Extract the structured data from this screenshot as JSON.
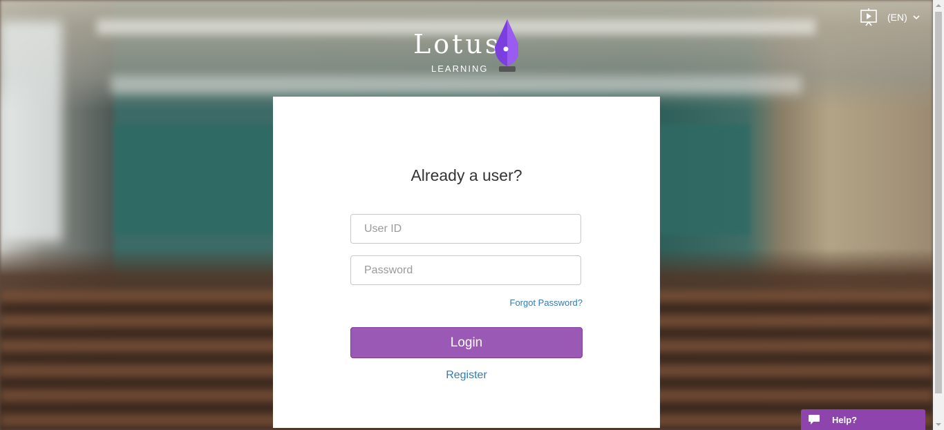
{
  "brand": {
    "name": "Lotus",
    "tagline": "LEARNING",
    "pen_color": "#8a47e6"
  },
  "header": {
    "tutorial_icon": "presentation-play-icon",
    "language": "(EN)",
    "language_icon": "chevron-down-icon"
  },
  "login": {
    "title": "Already a user?",
    "user_id_placeholder": "User ID",
    "user_id_value": "",
    "password_placeholder": "Password",
    "password_value": "",
    "forgot_label": "Forgot Password?",
    "login_label": "Login",
    "register_label": "Register",
    "accent_color": "#9b59b6",
    "link_color": "#337ab7"
  },
  "help_widget": {
    "label": "Help?",
    "icon": "chat-bubble-icon",
    "color": "#8e44ad"
  }
}
